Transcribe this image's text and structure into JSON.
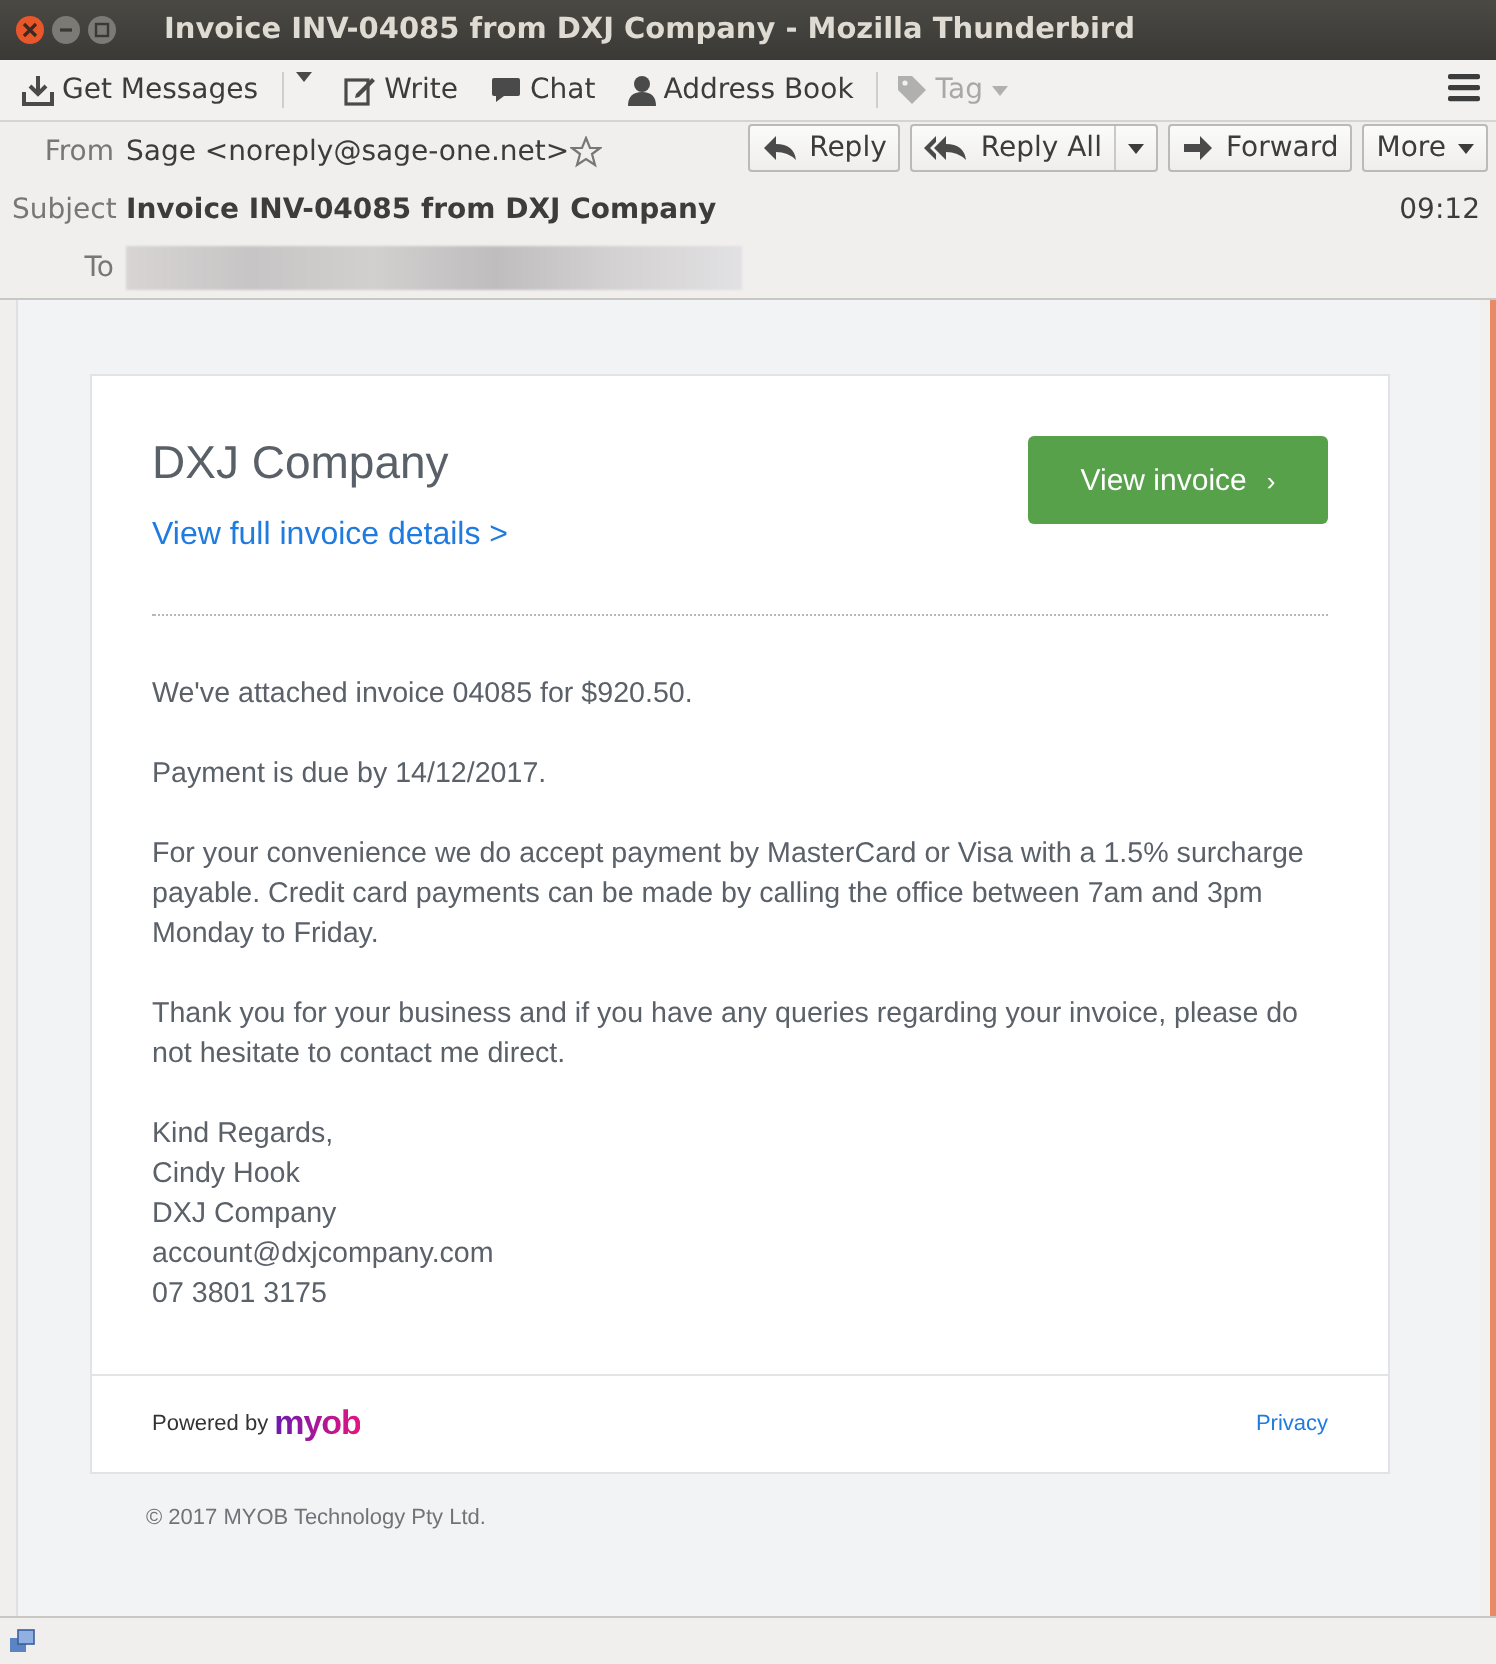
{
  "window": {
    "title": "Invoice INV-04085 from DXJ Company - Mozilla Thunderbird"
  },
  "toolbar": [
    {
      "kind": "get",
      "label": "Get Messages",
      "has_menu": true,
      "disabled": false
    },
    {
      "kind": "write",
      "label": "Write",
      "has_menu": false,
      "disabled": false
    },
    {
      "kind": "chat",
      "label": "Chat",
      "has_menu": false,
      "disabled": false
    },
    {
      "kind": "address",
      "label": "Address Book",
      "has_menu": false,
      "disabled": false
    },
    {
      "kind": "tag",
      "label": "Tag",
      "has_menu": true,
      "disabled": true
    }
  ],
  "header": {
    "from_label": "From",
    "from": "Sage <noreply@sage-one.net>",
    "subject_label": "Subject",
    "subject": "Invoice INV-04085 from DXJ Company",
    "time": "09:12",
    "to_label": "To",
    "buttons": [
      {
        "kind": "reply",
        "label": "Reply",
        "has_menu": false
      },
      {
        "kind": "replyall",
        "label": "Reply All",
        "has_menu": true
      },
      {
        "kind": "forward",
        "label": "Forward",
        "has_menu": false
      },
      {
        "kind": "more",
        "label": "More",
        "has_menu": true
      }
    ]
  },
  "email": {
    "company": "DXJ Company",
    "details_link": "View full invoice details >",
    "view_button": "View invoice",
    "view_button_arrow": "›",
    "paragraphs": [
      "We've attached invoice 04085 for $920.50.",
      "Payment is due by 14/12/2017.",
      "For your convenience we do accept payment by MasterCard or Visa with a 1.5% surcharge payable. Credit card payments can be made by calling the office between 7am and 3pm Monday to Friday.",
      "Thank you for your business and if you have any queries regarding your invoice, please do not hesitate to contact me direct."
    ],
    "signature": [
      "Kind Regards,",
      "Cindy Hook",
      "DXJ Company",
      "account@dxjcompany.com",
      "07 3801 3175"
    ],
    "powered_by": "Powered by",
    "logo": "myob",
    "privacy": "Privacy",
    "copyright": "© 2017 MYOB Technology Pty Ltd."
  }
}
